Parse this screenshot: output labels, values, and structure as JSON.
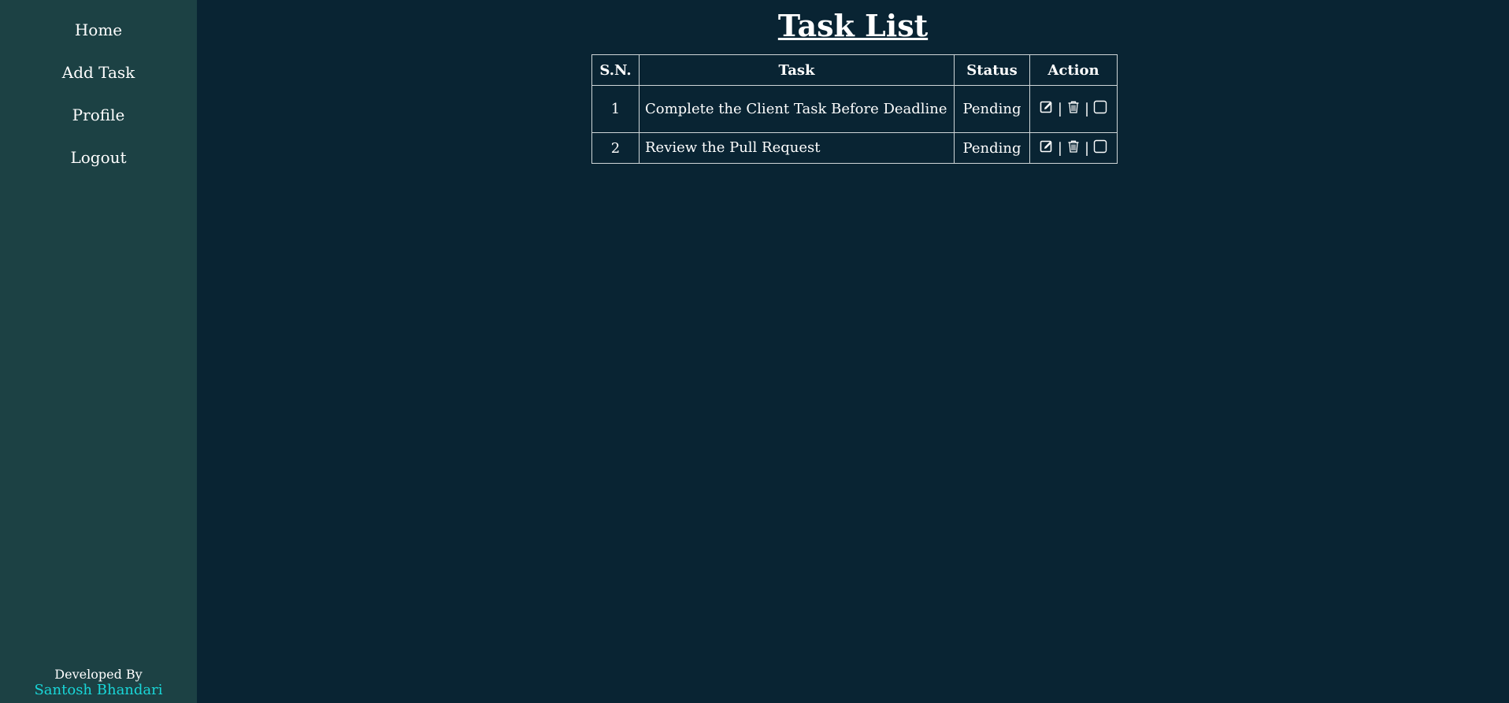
{
  "sidebar": {
    "nav": [
      {
        "label": "Home"
      },
      {
        "label": "Add Task"
      },
      {
        "label": "Profile"
      },
      {
        "label": "Logout"
      }
    ],
    "footer": {
      "developed_by": "Developed By",
      "author": "Santosh Bhandari"
    }
  },
  "main": {
    "title": "Task List",
    "table": {
      "headers": {
        "sn": "S.N.",
        "task": "Task",
        "status": "Status",
        "action": "Action"
      },
      "rows": [
        {
          "sn": "1",
          "task": "Complete the Client Task Before Deadline",
          "status": "Pending"
        },
        {
          "sn": "2",
          "task": "Review the Pull Request",
          "status": "Pending"
        }
      ],
      "action_separator": "|",
      "action_icons": [
        "edit-icon",
        "trash-icon",
        "checkbox-icon"
      ]
    }
  },
  "colors": {
    "background": "#092433",
    "sidebar": "#1c4144",
    "author": "#19d6d8",
    "border": "#cfd6d8"
  }
}
